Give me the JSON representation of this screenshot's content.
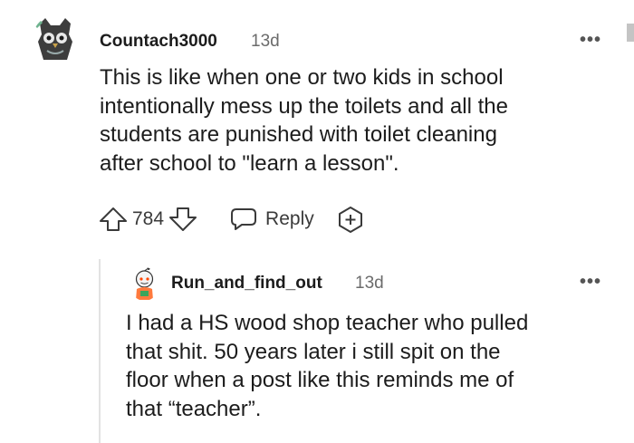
{
  "comment": {
    "username": "Countach3000",
    "age": "13d",
    "more_label": "•••",
    "text": "This is like when one or two kids in school\nintentionally mess up the toilets and all the\nstudents are punished with toilet cleaning\nafter school to \"learn a lesson\".",
    "score": "784",
    "reply_label": "Reply",
    "icons": {
      "avatar": "owl-avatar",
      "upvote": "upvote-arrow",
      "downvote": "downvote-arrow",
      "reply": "speech-bubble",
      "award": "plus-award"
    }
  },
  "reply": {
    "username": "Run_and_find_out",
    "age": "13d",
    "more_label": "•••",
    "text": "I had a HS wood shop teacher who pulled\nthat shit. 50 years later i still spit on the\nfloor when a post like this reminds me of\nthat “teacher”.",
    "icons": {
      "avatar": "snoo-avatar"
    }
  },
  "colors": {
    "text": "#1c1c1c",
    "meta": "#6b6b6b",
    "icon": "#3a3a3a"
  }
}
